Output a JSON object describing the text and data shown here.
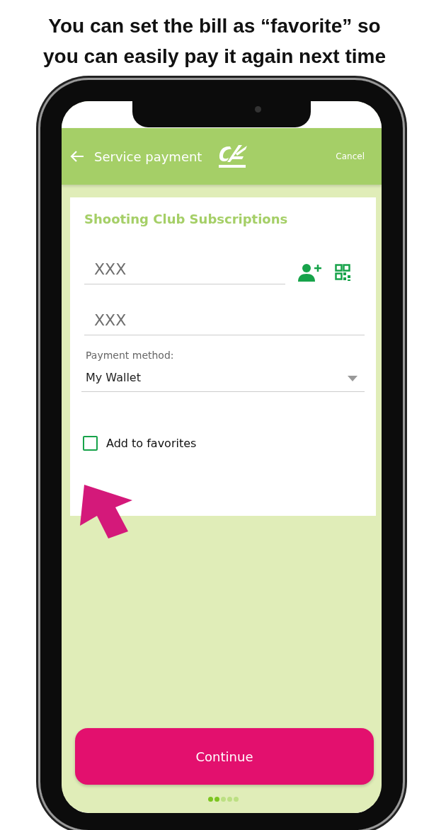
{
  "caption": [
    "You can set the bill as “favorite” so",
    "you can easily pay it again next time"
  ],
  "app_bar": {
    "title": "Service payment",
    "action": "Cancel"
  },
  "card": {
    "title": "Shooting Club Subscriptions",
    "fields": [
      {
        "value": "XXX"
      },
      {
        "value": "XXX"
      }
    ],
    "payment_method": {
      "label": "Payment method:",
      "value": "My Wallet"
    },
    "favorite": {
      "label": "Add to favorites",
      "checked": false
    }
  },
  "continue_button": "Continue",
  "page_dots": [
    {
      "selected": true
    },
    {
      "selected": true
    },
    {
      "selected": false
    },
    {
      "selected": false
    },
    {
      "selected": false
    }
  ]
}
